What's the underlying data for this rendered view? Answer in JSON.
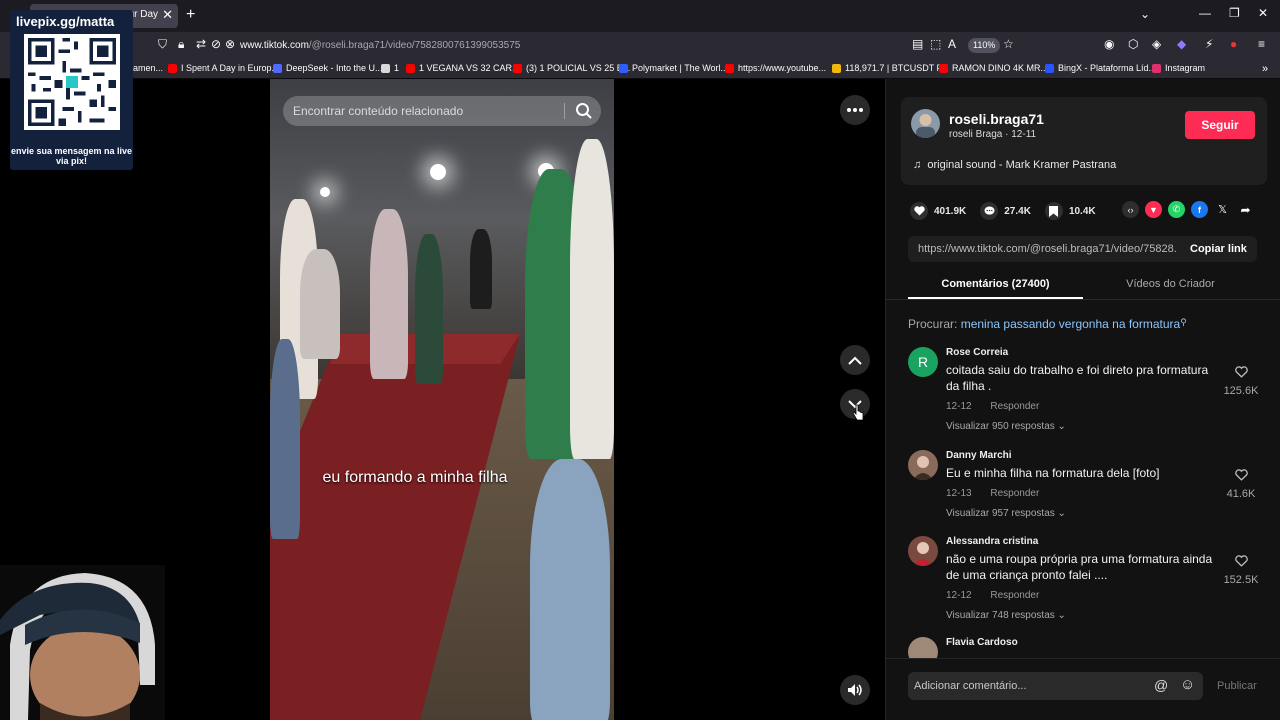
{
  "browser": {
    "tab_title": "our Day",
    "url_host": "www.tiktok.com",
    "url_path": "/@roseli.braga71/video/7582800761399053575",
    "zoom": "110%",
    "bookmarks": [
      {
        "label": "amen...",
        "color": "#e02020"
      },
      {
        "label": "I Spent A Day in Europ...",
        "color": "#ff0000"
      },
      {
        "label": "DeepSeek - Into the U...",
        "color": "#4d6bfe"
      },
      {
        "label": "1",
        "color": "#d9d9d9"
      },
      {
        "label": "1 VEGANA VS 32 CAR...",
        "color": "#ff0000"
      },
      {
        "label": "(3) 1 POLICIAL VS 25 E...",
        "color": "#ff0000"
      },
      {
        "label": "Polymarket | The Worl...",
        "color": "#2c5fff"
      },
      {
        "label": "https://www.youtube...",
        "color": "#ff0000"
      },
      {
        "label": "118,971.7 | BTCUSDT P...",
        "color": "#f0b90b"
      },
      {
        "label": "RAMON DINO 4K MR...",
        "color": "#ff0000"
      },
      {
        "label": "BingX - Plataforma Líd...",
        "color": "#2a54ff"
      },
      {
        "label": "Instagram",
        "color": "#e1306c"
      }
    ]
  },
  "overlay": {
    "qr_url": "livepix.gg/matta",
    "qr_message": "envie sua mensagem na live via pix!"
  },
  "video": {
    "search_placeholder": "Encontrar conteúdo relacionado",
    "caption": "eu formando a minha filha"
  },
  "author": {
    "username": "roseli.braga71",
    "display_name": "roseli Braga · 12-11",
    "follow_label": "Seguir",
    "music": "original sound - Mark Kramer Pastrana"
  },
  "stats": {
    "likes": "401.9K",
    "comments": "27.4K",
    "saves": "10.4K"
  },
  "share": {
    "link": "https://www.tiktok.com/@roseli.braga71/video/75828...",
    "copy_label": "Copiar link"
  },
  "tabs": {
    "comments": "Comentários (27400)",
    "videos": "Vídeos do Criador"
  },
  "related_search": {
    "label": "Procurar:",
    "term": "menina passando vergonha na formatura"
  },
  "comments": [
    {
      "name": "Rose Correia",
      "text": "coitada saiu do trabalho e foi direto pra formatura da filha .",
      "date": "12-12",
      "reply": "Responder",
      "views": "Visualizar 950 respostas",
      "likes": "125.6K",
      "avatar_color": "#1aa260",
      "initial": "R"
    },
    {
      "name": "Danny Marchi",
      "text": "Eu e minha filha na formatura dela [foto]",
      "date": "12-13",
      "reply": "Responder",
      "views": "Visualizar 957 respostas",
      "likes": "41.6K",
      "avatar_color": "#8a6a5a",
      "initial": ""
    },
    {
      "name": "Alessandra cristina",
      "text": "não e uma roupa própria pra uma formatura ainda de uma criança pronto falei ....",
      "date": "12-12",
      "reply": "Responder",
      "views": "Visualizar 748 respostas",
      "likes": "152.5K",
      "avatar_color": "#7a4a40",
      "initial": ""
    },
    {
      "name": "Flavia Cardoso",
      "text": "",
      "date": "",
      "reply": "",
      "views": "",
      "likes": "",
      "avatar_color": "#a08878",
      "initial": ""
    }
  ],
  "composer": {
    "placeholder": "Adicionar comentário...",
    "publish_label": "Publicar"
  },
  "colors": {
    "accent": "#fe2c55",
    "link": "#8ac6ff",
    "panel": "#121212"
  }
}
